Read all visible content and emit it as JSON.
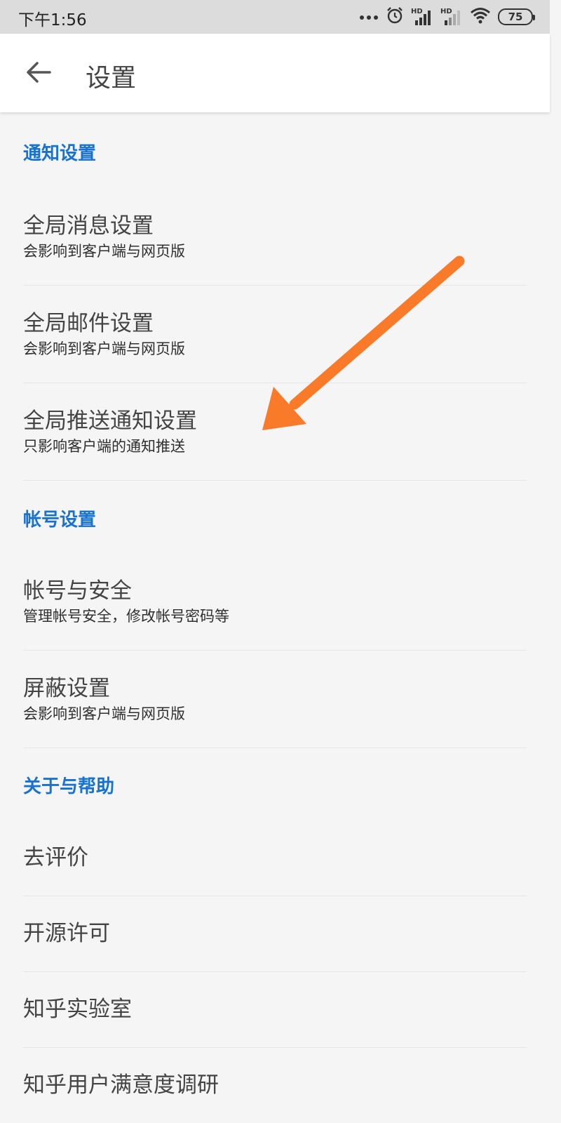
{
  "status_bar": {
    "time": "下午1:56",
    "hd1": "HD",
    "hd2": "HD",
    "battery": "75"
  },
  "app_bar": {
    "title": "设置"
  },
  "sections": {
    "notify": "通知设置",
    "account": "帐号设置",
    "about": "关于与帮助"
  },
  "items": {
    "global_message": {
      "title": "全局消息设置",
      "subtitle": "会影响到客户端与网页版"
    },
    "global_mail": {
      "title": "全局邮件设置",
      "subtitle": "会影响到客户端与网页版"
    },
    "global_push": {
      "title": "全局推送通知设置",
      "subtitle": "只影响客户端的通知推送"
    },
    "account_security": {
      "title": "帐号与安全",
      "subtitle": "管理帐号安全，修改帐号密码等"
    },
    "block": {
      "title": "屏蔽设置",
      "subtitle": "会影响到客户端与网页版"
    },
    "rate": {
      "title": "去评价"
    },
    "open_source": {
      "title": "开源许可"
    },
    "lab": {
      "title": "知乎实验室"
    },
    "survey": {
      "title": "知乎用户满意度调研"
    }
  },
  "annotation": {
    "arrow_color": "#f97b2a"
  }
}
